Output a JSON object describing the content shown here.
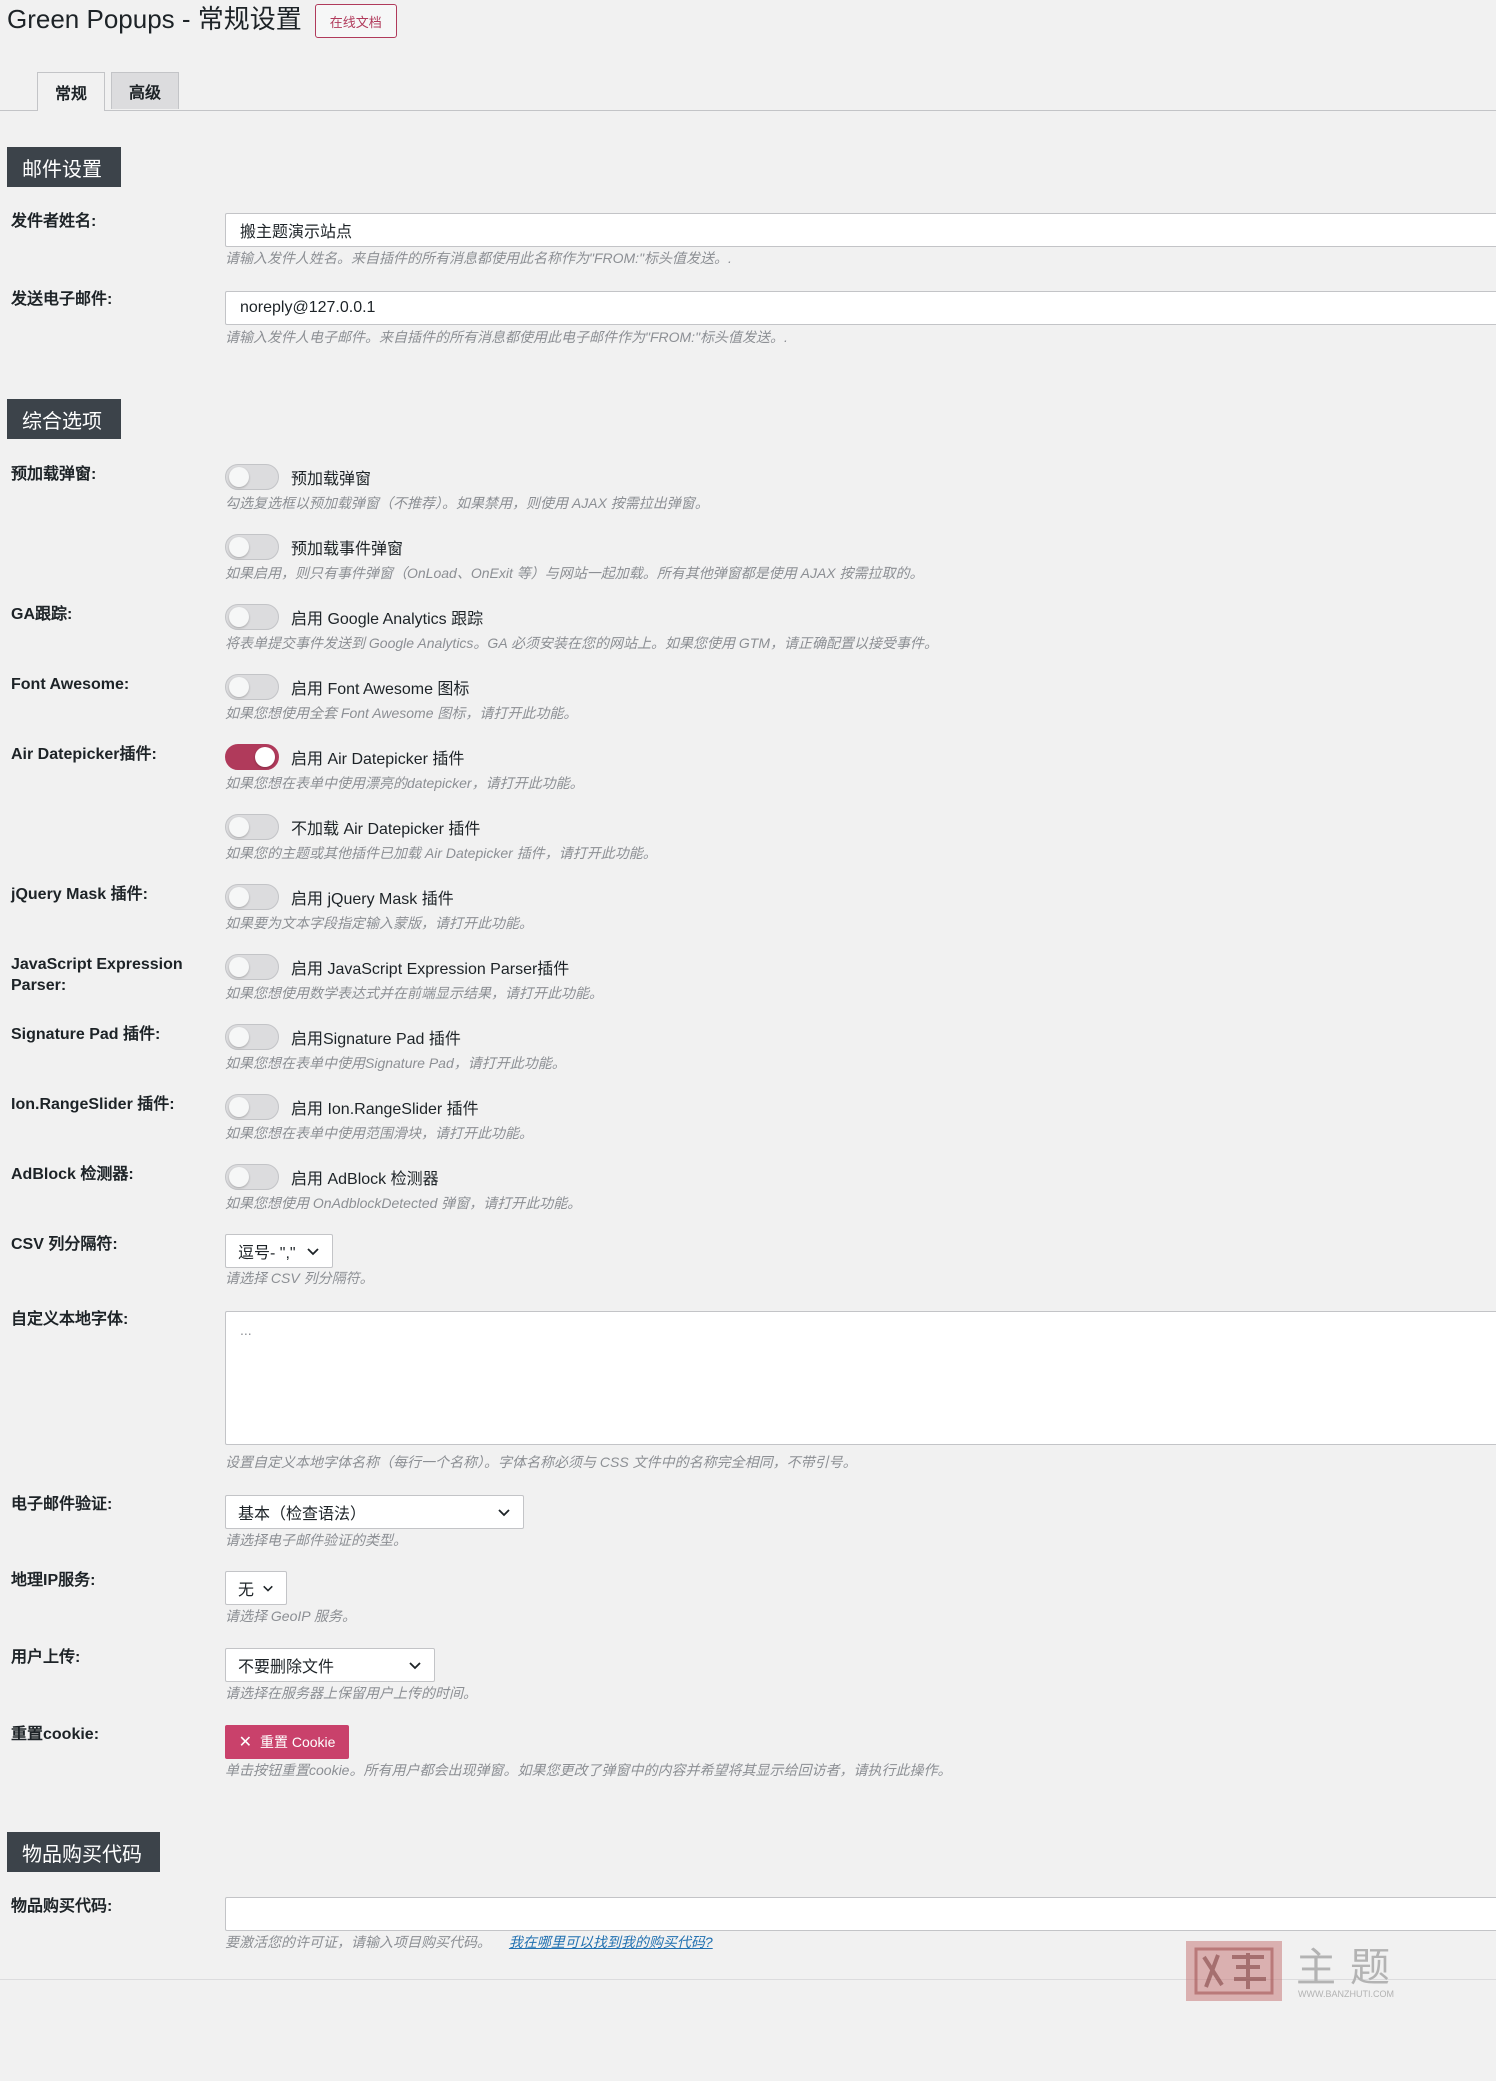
{
  "header": {
    "title": "Green Popups - 常规设置",
    "doc_button": "在线文档"
  },
  "tabs": [
    {
      "label": "常规",
      "active": true
    },
    {
      "label": "高级",
      "active": false
    }
  ],
  "mail_section": {
    "title": "邮件设置",
    "sender_name": {
      "label": "发件者姓名:",
      "value": "搬主题演示站点",
      "desc": "请输入发件人姓名。来自插件的所有消息都使用此名称作为\"FROM:\"标头值发送。."
    },
    "sender_email": {
      "label": "发送电子邮件:",
      "value": "noreply@127.0.0.1",
      "desc": "请输入发件人电子邮件。来自插件的所有消息都使用此电子邮件作为\"FROM:\"标头值发送。."
    }
  },
  "general_section": {
    "title": "综合选项",
    "preload": {
      "label": "预加载弹窗:",
      "toggle1_label": "预加载弹窗",
      "toggle1_on": false,
      "toggle1_desc": "勾选复选框以预加载弹窗（不推荐）。如果禁用，则使用 AJAX 按需拉出弹窗。",
      "toggle2_label": "预加载事件弹窗",
      "toggle2_on": false,
      "toggle2_desc": "如果启用，则只有事件弹窗（OnLoad、OnExit 等）与网站一起加载。所有其他弹窗都是使用 AJAX 按需拉取的。"
    },
    "ga": {
      "label": "GA跟踪:",
      "toggle_label": "启用 Google Analytics 跟踪",
      "on": false,
      "desc": "将表单提交事件发送到 Google Analytics。GA 必须安装在您的网站上。如果您使用 GTM，请正确配置以接受事件。"
    },
    "font_awesome": {
      "label": "Font Awesome:",
      "toggle_label": "启用 Font Awesome 图标",
      "on": false,
      "desc": "如果您想使用全套 Font Awesome 图标，请打开此功能。"
    },
    "datepicker": {
      "label": "Air Datepicker插件:",
      "toggle1_label": "启用 Air Datepicker 插件",
      "toggle1_on": true,
      "toggle1_desc": "如果您想在表单中使用漂亮的datepicker，请打开此功能。",
      "toggle2_label": "不加载 Air Datepicker 插件",
      "toggle2_on": false,
      "toggle2_desc": "如果您的主题或其他插件已加载 Air Datepicker 插件，请打开此功能。"
    },
    "jquery_mask": {
      "label": "jQuery Mask 插件:",
      "toggle_label": "启用 jQuery Mask 插件",
      "on": false,
      "desc": "如果要为文本字段指定输入蒙版，请打开此功能。"
    },
    "js_expression": {
      "label_line1": "JavaScript Expression",
      "label_line2": "Parser:",
      "toggle_label": "启用 JavaScript Expression Parser插件",
      "on": false,
      "desc": "如果您想使用数学表达式并在前端显示结果，请打开此功能。"
    },
    "signature_pad": {
      "label": "Signature Pad 插件:",
      "toggle_label": "启用Signature Pad 插件",
      "on": false,
      "desc": "如果您想在表单中使用Signature Pad，请打开此功能。"
    },
    "range_slider": {
      "label": "Ion.RangeSlider 插件:",
      "toggle_label": "启用 Ion.RangeSlider 插件",
      "on": false,
      "desc": "如果您想在表单中使用范围滑块，请打开此功能。"
    },
    "adblock": {
      "label": "AdBlock 检测器:",
      "toggle_label": "启用 AdBlock 检测器",
      "on": false,
      "desc": "如果您想使用 OnAdblockDetected 弹窗，请打开此功能。"
    },
    "csv": {
      "label": "CSV 列分隔符:",
      "value": "逗号- \",\"",
      "desc": "请选择 CSV 列分隔符。"
    },
    "custom_fonts": {
      "label": "自定义本地字体:",
      "placeholder": "...",
      "desc": "设置自定义本地字体名称（每行一个名称）。字体名称必须与 CSS 文件中的名称完全相同，不带引号。"
    },
    "email_validation": {
      "label": "电子邮件验证:",
      "value": "基本（检查语法）",
      "desc": "请选择电子邮件验证的类型。"
    },
    "geoip": {
      "label": "地理IP服务:",
      "value": "无",
      "desc": "请选择 GeoIP 服务。"
    },
    "uploads": {
      "label": "用户上传:",
      "value": "不要删除文件",
      "desc": "请选择在服务器上保留用户上传的时间。"
    },
    "reset_cookie": {
      "label": "重置cookie:",
      "button": "重置 Cookie",
      "desc": "单击按钮重置cookie。所有用户都会出现弹窗。如果您更改了弹窗中的内容并希望将其显示给回访者，请执行此操作。"
    }
  },
  "purchase_section": {
    "title": "物品购买代码",
    "label": "物品购买代码:",
    "value": "",
    "desc": "要激活您的许可证，请输入项目购买代码。",
    "link": "我在哪里可以找到我的购买代码?"
  },
  "watermark": {
    "text": "主题",
    "url": "WWW.BANZHUTI.COM"
  },
  "colors": {
    "accent": "#c9416b",
    "section_bg": "#3c434a",
    "page_bg": "#f1f1f1"
  }
}
